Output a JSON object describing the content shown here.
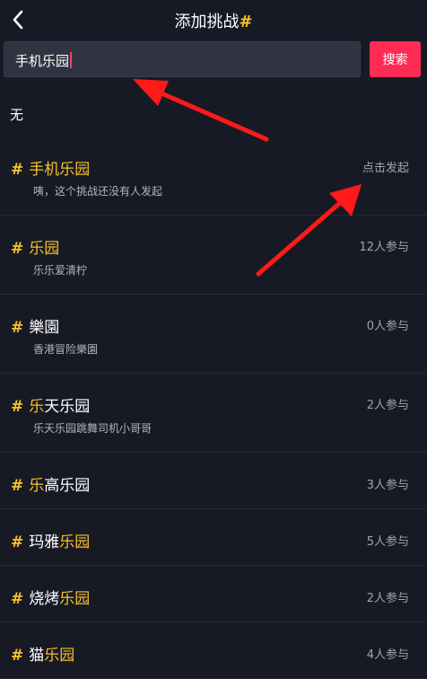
{
  "header": {
    "title": "添加挑战",
    "title_hash": "#",
    "back_icon": "chevron-left-icon"
  },
  "search": {
    "value": "手机乐园",
    "button_label": "搜索"
  },
  "none_label": "无",
  "results": [
    {
      "hash": "#",
      "pre": "",
      "hl": "手机乐园",
      "post": "",
      "desc": "咦，这个挑战还没有人发起",
      "meta": "点击发起"
    },
    {
      "hash": "#",
      "pre": "",
      "hl": "乐园",
      "post": "",
      "desc": "乐乐爱清柠",
      "meta": "12人参与"
    },
    {
      "hash": "#",
      "pre": "樂園",
      "hl": "",
      "post": "",
      "desc": "香港冒险樂園",
      "meta": "0人参与"
    },
    {
      "hash": "#",
      "pre": "",
      "hl": "乐",
      "post": "天乐园",
      "desc": "乐天乐园跳舞司机小哥哥",
      "meta": "2人参与"
    },
    {
      "hash": "#",
      "pre": "",
      "hl": "乐",
      "post": "高乐园",
      "desc": "",
      "meta": "3人参与"
    },
    {
      "hash": "#",
      "pre": "玛雅",
      "hl": "乐园",
      "post": "",
      "desc": "",
      "meta": "5人参与"
    },
    {
      "hash": "#",
      "pre": "烧烤",
      "hl": "乐园",
      "post": "",
      "desc": "",
      "meta": "2人参与"
    },
    {
      "hash": "#",
      "pre": "猫",
      "hl": "乐园",
      "post": "",
      "desc": "",
      "meta": "4人参与"
    }
  ],
  "colors": {
    "background": "#171a25",
    "accent_yellow": "#f6c12c",
    "search_button": "#fe2c55",
    "annotation_arrow": "#ff1a1a"
  }
}
